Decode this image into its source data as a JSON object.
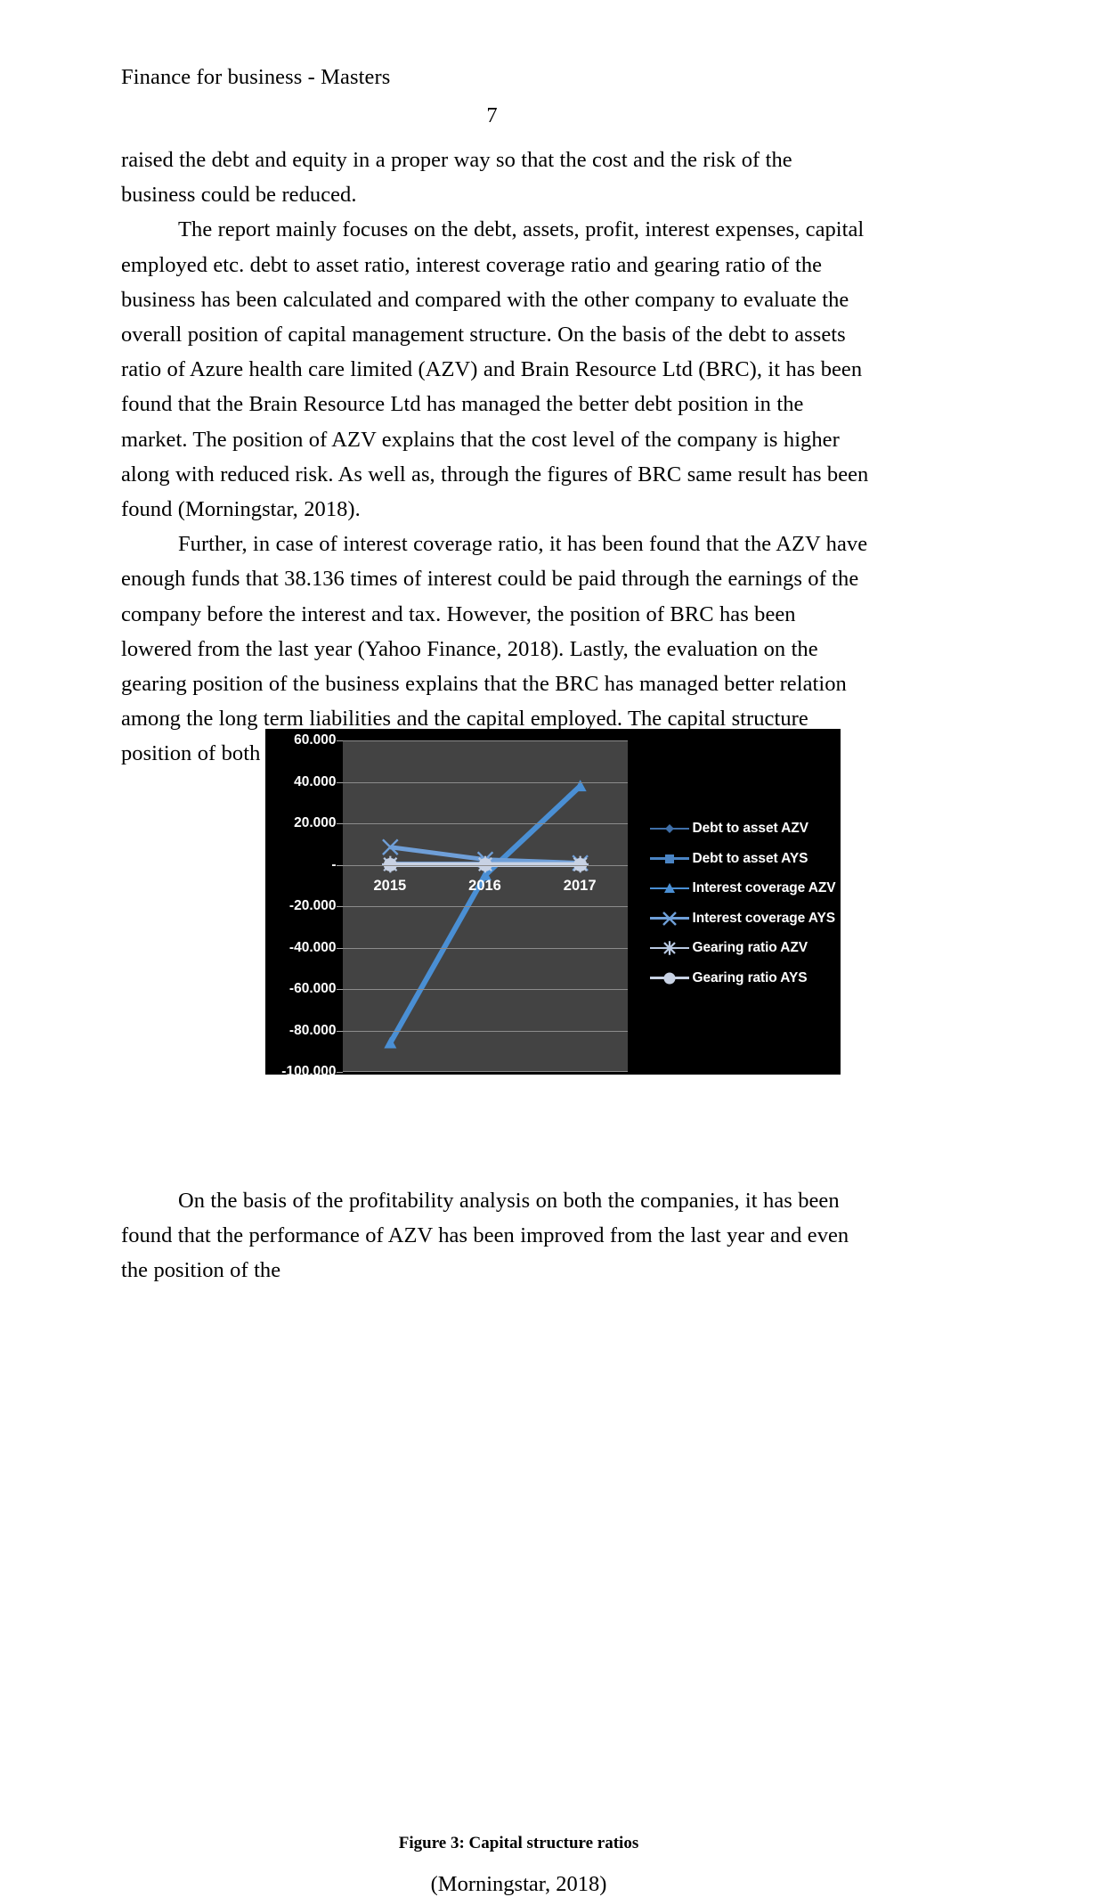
{
  "header": {
    "running_head": "Finance for business - Masters",
    "page_number": "7"
  },
  "body": {
    "paragraphs": [
      "raised the debt and equity in a proper way so that the cost and the risk of the business could be reduced.",
      "The report mainly focuses on the debt, assets, profit, interest expenses, capital employed etc. debt to asset ratio, interest coverage ratio and gearing ratio of the business has been calculated and compared with the other company to evaluate the overall position of capital management structure. On the basis of the debt to assets ratio of Azure health care limited (AZV) and Brain Resource Ltd (BRC), it has been found that the Brain Resource Ltd has managed the better debt position in the market. The position of AZV explains that the cost level of the company is higher along with reduced risk. As well as, through the figures of BRC same result has been found (Morningstar, 2018).",
      "Further, in case of interest coverage ratio, it has been found that the AZV have enough funds that 38.136 times of interest could be paid through the earnings of the company before the interest and tax. However, the position of BRC has been lowered from the last year (Yahoo Finance, 2018).  Lastly, the evaluation on the gearing position of the business explains that the BRC has managed better relation among the long term liabilities and the capital employed. The capital structure position of both the companies are similar."
    ]
  },
  "figure": {
    "caption": "Figure 3: Capital structure ratios",
    "source": "(Morningstar, 2018)"
  },
  "tail": {
    "paragraphs": [
      "On the basis of the profitability analysis on both the companies, it has been found that the performance of AZV has been improved from the last year and even the position of the"
    ]
  },
  "chart_data": {
    "type": "line",
    "title": "",
    "xlabel": "",
    "ylabel": "",
    "categories": [
      "2015",
      "2016",
      "2017"
    ],
    "ytick_labels": [
      "60.000",
      "40.000",
      "20.000",
      "-",
      "-20.000",
      "-40.000",
      "-60.000",
      "-80.000",
      "-100.000"
    ],
    "ytick_values": [
      60,
      40,
      20,
      0,
      -20,
      -40,
      -60,
      -80,
      -100
    ],
    "ylim": [
      -100,
      60
    ],
    "grid": true,
    "legend_position": "right",
    "plot_background": "#434343",
    "chart_background": "#000000",
    "series": [
      {
        "name": "Debt to asset AZV",
        "marker": "diamond",
        "color": "#3f6fa8",
        "values": [
          0.5,
          0.5,
          0.5
        ]
      },
      {
        "name": "Debt to asset AYS",
        "marker": "square",
        "color": "#4a84c4",
        "values": [
          0.3,
          0.3,
          0.3
        ]
      },
      {
        "name": "Interest coverage AZV",
        "marker": "triangle",
        "color": "#4a8fd4",
        "values": [
          -86,
          -5,
          38
        ]
      },
      {
        "name": "Interest coverage AYS",
        "marker": "x",
        "color": "#6f9fd8",
        "values": [
          8.5,
          2.5,
          0.8
        ]
      },
      {
        "name": "Gearing ratio AZV",
        "marker": "asterisk",
        "color": "#b9c9e2",
        "values": [
          0.2,
          0.2,
          0.2
        ]
      },
      {
        "name": "Gearing ratio AYS",
        "marker": "circle",
        "color": "#c8d2e4",
        "values": [
          0,
          0,
          0
        ]
      }
    ]
  }
}
